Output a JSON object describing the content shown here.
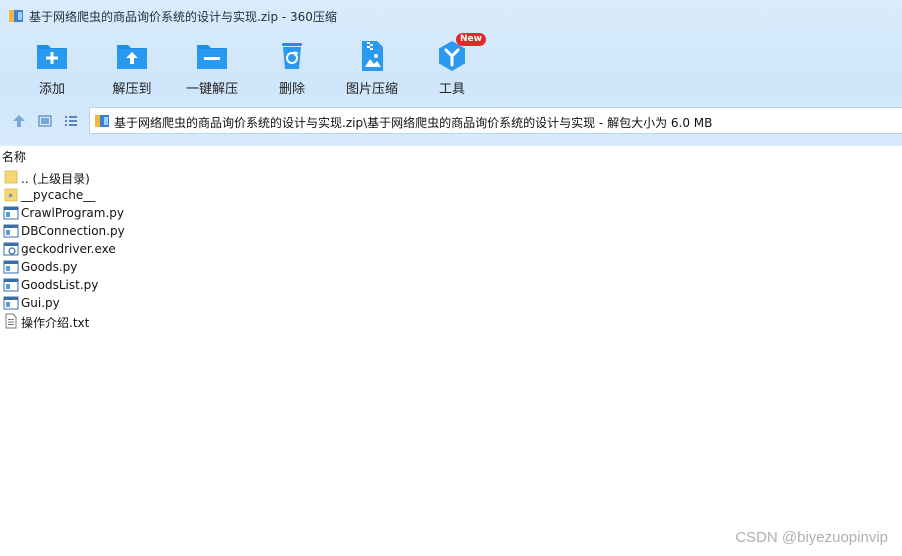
{
  "window": {
    "title": "基于网络爬虫的商品询价系统的设计与实现.zip - 360压缩"
  },
  "toolbar": {
    "items": [
      {
        "label": "添加",
        "icon": "add-folder-icon"
      },
      {
        "label": "解压到",
        "icon": "extract-to-icon"
      },
      {
        "label": "一键解压",
        "icon": "one-click-extract-icon"
      },
      {
        "label": "删除",
        "icon": "recycle-bin-icon"
      },
      {
        "label": "图片压缩",
        "icon": "image-compress-icon"
      },
      {
        "label": "工具",
        "icon": "tools-icon",
        "badge": "New"
      }
    ]
  },
  "address": {
    "path": "基于网络爬虫的商品询价系统的设计与实现.zip\\基于网络爬虫的商品询价系统的设计与实现 - 解包大小为 6.0 MB"
  },
  "filelist": {
    "column_name": "名称",
    "items": [
      {
        "name": ".. (上级目录)",
        "type": "folder"
      },
      {
        "name": "__pycache__",
        "type": "folder"
      },
      {
        "name": "CrawlProgram.py",
        "type": "py"
      },
      {
        "name": "DBConnection.py",
        "type": "py"
      },
      {
        "name": "geckodriver.exe",
        "type": "exe"
      },
      {
        "name": "Goods.py",
        "type": "py"
      },
      {
        "name": "GoodsList.py",
        "type": "py"
      },
      {
        "name": "Gui.py",
        "type": "py"
      },
      {
        "name": "操作介绍.txt",
        "type": "txt"
      }
    ]
  },
  "watermark": "CSDN @biyezuopinvip",
  "colors": {
    "accent": "#1e8fe1",
    "chrome_bg": "#d4e9fb",
    "badge": "#e8262c"
  }
}
